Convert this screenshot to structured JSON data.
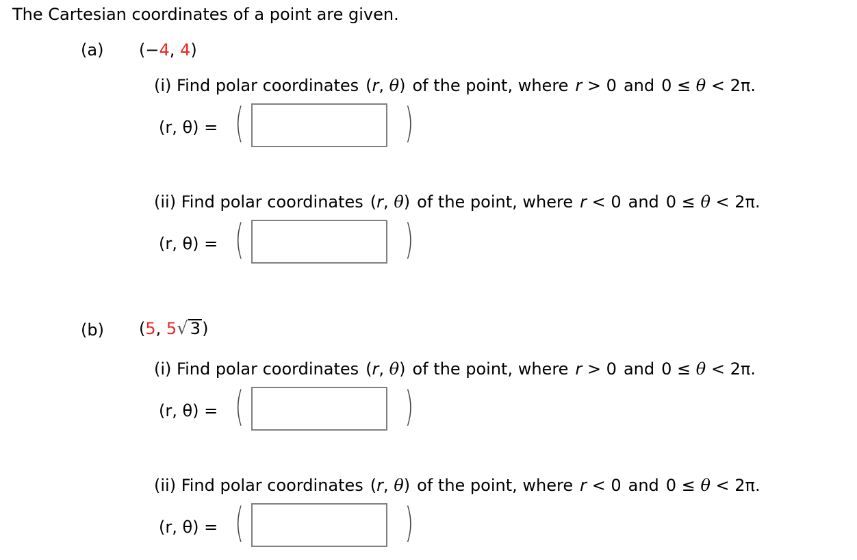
{
  "title": "The Cartesian coordinates of a point are given.",
  "accent_color": "#e8281e",
  "parts": [
    {
      "label": "(a)",
      "point": {
        "open": "(",
        "neg": "−",
        "x": "4",
        "sep": ", ",
        "y": "4",
        "close": ")"
      },
      "questions": [
        {
          "prefix": "(i) Find polar coordinates",
          "pair_open": "(",
          "r": "r",
          "comma": ", ",
          "theta": "θ",
          "pair_close": ")",
          "of_text": "of the point, where",
          "cond_r": "r",
          "cond_rel": "> 0",
          "and": "and",
          "range": "0 ≤",
          "range_theta": "θ",
          "range_end": "< 2π.",
          "eq_label": "(r, θ) =",
          "answer_value": ""
        },
        {
          "prefix": "(ii) Find polar coordinates",
          "pair_open": "(",
          "r": "r",
          "comma": ", ",
          "theta": "θ",
          "pair_close": ")",
          "of_text": "of the point, where",
          "cond_r": "r",
          "cond_rel": "< 0",
          "and": "and",
          "range": "0 ≤",
          "range_theta": "θ",
          "range_end": "< 2π.",
          "eq_label": "(r, θ) =",
          "answer_value": ""
        }
      ]
    },
    {
      "label": "(b)",
      "point": {
        "open": "(",
        "x": "5",
        "sep": ", ",
        "y_coef": "5",
        "sqrt_sign": "√",
        "radicand": "3",
        "close": ")"
      },
      "questions": [
        {
          "prefix": "(i) Find polar coordinates",
          "pair_open": "(",
          "r": "r",
          "comma": ", ",
          "theta": "θ",
          "pair_close": ")",
          "of_text": "of the point, where",
          "cond_r": "r",
          "cond_rel": "> 0",
          "and": "and",
          "range": "0 ≤",
          "range_theta": "θ",
          "range_end": "< 2π.",
          "eq_label": "(r, θ) =",
          "answer_value": ""
        },
        {
          "prefix": "(ii) Find polar coordinates",
          "pair_open": "(",
          "r": "r",
          "comma": ", ",
          "theta": "θ",
          "pair_close": ")",
          "of_text": "of the point, where",
          "cond_r": "r",
          "cond_rel": "< 0",
          "and": "and",
          "range": "0 ≤",
          "range_theta": "θ",
          "range_end": "< 2π.",
          "eq_label": "(r, θ) =",
          "answer_value": ""
        }
      ]
    }
  ],
  "paren_open": "(",
  "paren_close": ")"
}
